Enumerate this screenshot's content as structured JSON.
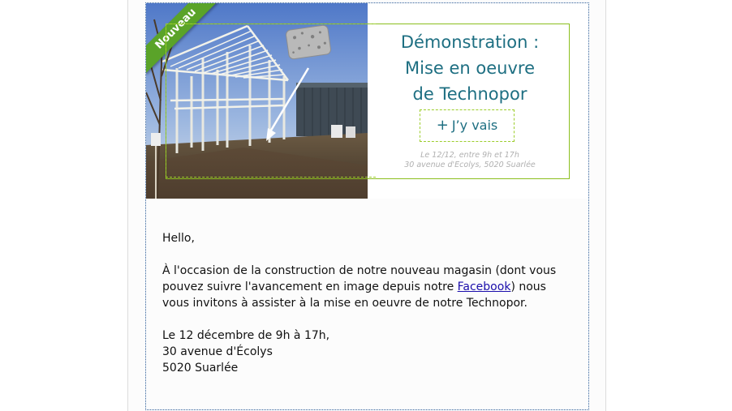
{
  "banner": {
    "ribbon_label": "Nouveau",
    "title_line1": "Démonstration :",
    "title_line2": "Mise en oeuvre",
    "title_line3": "de Technopor",
    "cta_plus": "+",
    "cta_label": "J’y vais",
    "meta_line1": "Le 12/12, entre 9h et 17h",
    "meta_line2": "30 avenue d'Ecolys, 5020 Suarlée"
  },
  "message": {
    "greeting": "Hello,",
    "para_part1": "À l'occasion de la construction de notre nouveau magasin (dont vous pouvez suivre l'avancement en image depuis notre ",
    "link_text": "Facebook",
    "para_part2": ") nous vous invitons à assister à la mise en oeuvre de notre Technopor.",
    "date_line": "Le 12 décembre de 9h à 17h,",
    "address_line1": "30 avenue d'Écolys",
    "address_line2": "5020 Suarlée"
  },
  "colors": {
    "accent_teal": "#1e6f82",
    "accent_green": "#8bbf1e",
    "ribbon_green": "#5aa329",
    "card_border": "#2f5f9a"
  }
}
